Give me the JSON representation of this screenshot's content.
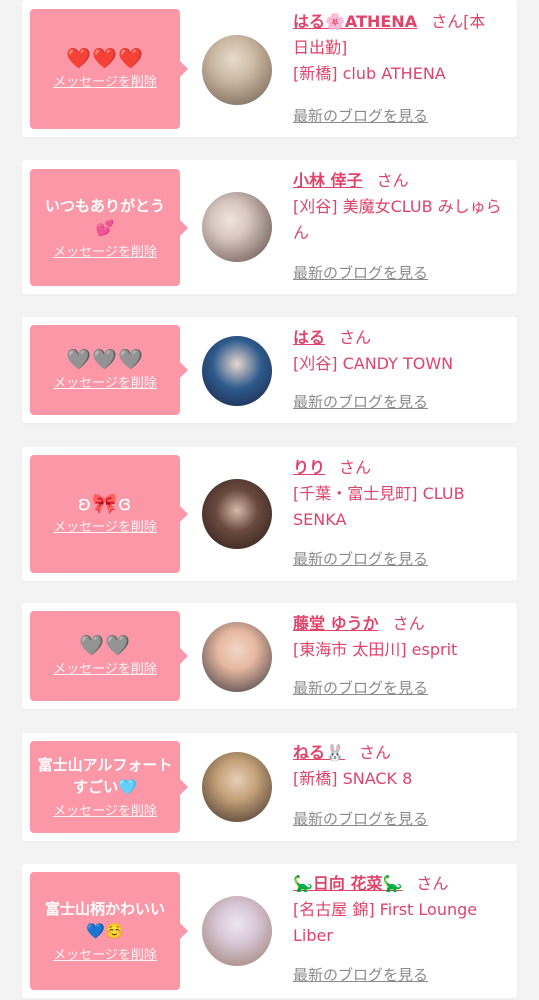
{
  "cards": [
    {
      "message": "❤️❤️❤️",
      "message_is_icons": true,
      "delete_label": "メッセージを削除",
      "name": "はる🌸ATHENA",
      "honorific": "さん",
      "shop": "[本日出勤]\n[新橋] club ATHENA",
      "blog_label": "最新のブログを見る",
      "avatar_colors": [
        "#cbb9a3",
        "#6b5a4c"
      ]
    },
    {
      "message": "いつもありがとう💕",
      "message_is_icons": false,
      "delete_label": "メッセージを削除",
      "name": "小林 倖子",
      "honorific": "さん",
      "shop": "[刈谷] 美魔女CLUB みしゅらん",
      "blog_label": "最新のブログを見る",
      "avatar_colors": [
        "#d9c8c2",
        "#5a4640"
      ]
    },
    {
      "message": "🩶🩶🩶",
      "message_is_icons": true,
      "delete_label": "メッセージを削除",
      "name": "はる",
      "honorific": "さん",
      "shop": "[刈谷] CANDY TOWN",
      "blog_label": "最新のブログを見る",
      "avatar_colors": [
        "#2d5a8c",
        "#1a2240"
      ]
    },
    {
      "message": "ʚ🎀ɞ",
      "message_is_icons": true,
      "delete_label": "メッセージを削除",
      "name": "りり",
      "honorific": "さん",
      "shop": "[千葉・富士見町] CLUB SENKA",
      "blog_label": "最新のブログを見る",
      "avatar_colors": [
        "#6a4a3e",
        "#2a1c18"
      ]
    },
    {
      "message": "🩶🩶",
      "message_is_icons": true,
      "delete_label": "メッセージを削除",
      "name": "藤堂 ゆうか",
      "honorific": "さん",
      "shop": "[東海市 太田川] esprit",
      "blog_label": "最新のブログを見る",
      "avatar_colors": [
        "#e7b8a0",
        "#33333a"
      ]
    },
    {
      "message": "富士山アルフォートすごい🩵",
      "message_is_icons": false,
      "delete_label": "メッセージを削除",
      "name": "ねる🐰",
      "honorific": "さん",
      "shop": "[新橋] SNACK 8",
      "blog_label": "最新のブログを見る",
      "avatar_colors": [
        "#c6a37a",
        "#3b2e28"
      ]
    },
    {
      "message": "富士山柄かわいい💙☺️",
      "message_is_icons": false,
      "delete_label": "メッセージを削除",
      "name": "🦕日向 花菜🦕",
      "honorific": "さん",
      "shop": "[名古屋 錦] First Lounge Liber",
      "blog_label": "最新のブログを見る",
      "avatar_colors": [
        "#d8c8d8",
        "#9a7a6a"
      ]
    }
  ]
}
